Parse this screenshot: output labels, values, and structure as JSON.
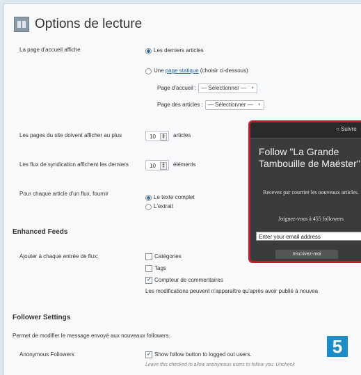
{
  "header": {
    "title": "Options de lecture",
    "icon": "settings-page-icon"
  },
  "front_page": {
    "label": "La page d'accueil affiche",
    "option_latest": "Les derniers articles",
    "option_static_prefix": "Une",
    "option_static_link": "page statique",
    "option_static_suffix": "(choisir ci-dessous)",
    "home_label": "Page d'accueil :",
    "home_select": "— Sélectionner —",
    "posts_label": "Page des articles :",
    "posts_select": "— Sélectionner —"
  },
  "posts_per_page": {
    "label": "Les pages du site doivent afficher au plus",
    "value": "10",
    "unit": "articles"
  },
  "feed_items": {
    "label": "Les flux de syndication affichent les derniers",
    "value": "10",
    "unit": "éléments"
  },
  "feed_content": {
    "label": "Pour chaque article d'un flux, fournir",
    "option_full": "Le texte complet",
    "option_excerpt": "L'extrait"
  },
  "enhanced_feeds": {
    "heading": "Enhanced Feeds",
    "label": "Ajouter à chaque entrée de flux:",
    "opt_categories": "Catégories",
    "opt_tags": "Tags",
    "opt_comments": "Compteur de commentaires",
    "note": "Les modifications peuvent n'apparaître qu'après avoir publié à nouvea"
  },
  "follower_settings": {
    "heading": "Follower Settings",
    "description": "Permet de modifier le message envoyé aux nouveaux followers.",
    "anon_label": "Anonymous Followers",
    "anon_option": "Show follow button to logged out users.",
    "anon_hint": "Leave this checked to allow anonymous users to follow you. Uncheck"
  },
  "follow_popup": {
    "button": "Suivre",
    "title": "Follow \"La Grande Tambouille de Maëster\"",
    "subtitle": "Recevez par courrier les nouveaux articles.",
    "count_text": "Joignez-vous à 455 followers",
    "email_placeholder": "Enter your email address",
    "subscribe": "Inscrivez-moi"
  },
  "badge": {
    "number": "5"
  },
  "colors": {
    "popup_border": "#c21d2e",
    "badge": "#1e8cc8",
    "link": "#2063a8"
  }
}
